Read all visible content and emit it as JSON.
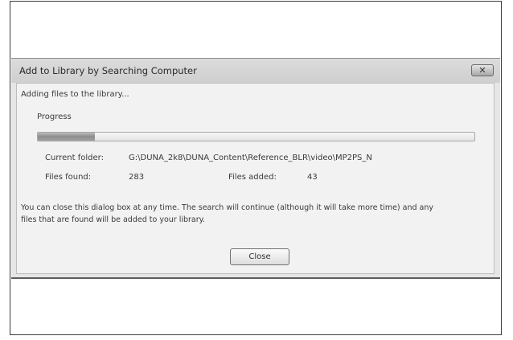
{
  "dialog": {
    "title": "Add to Library by Searching Computer",
    "close_icon": "close-x-icon",
    "status": "Adding files to the library...",
    "progress_label": "Progress",
    "progress_value": 0.13,
    "current_folder_label": "Current folder:",
    "current_folder_value": "G:\\DUNA_2k8\\DUNA_Content\\Reference_BLR\\video\\MP2PS_N",
    "files_found_label": "Files found:",
    "files_found_value": "283",
    "files_added_label": "Files added:",
    "files_added_value": "43",
    "info_line1": "You can close this dialog box at any time. The search will continue (although it will take more time) and any",
    "info_line2": "files that are found will be added to your library.",
    "close_button": "Close"
  }
}
